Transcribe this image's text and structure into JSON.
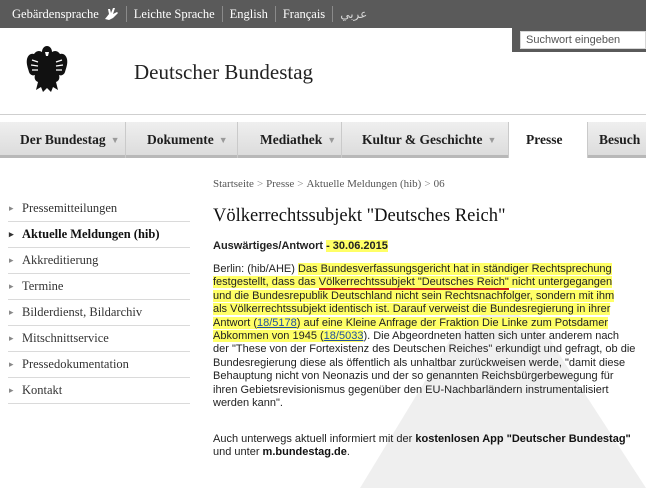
{
  "topbar": {
    "items": [
      "Gebärdensprache",
      "Leichte Sprache",
      "English",
      "Français",
      "عربي"
    ]
  },
  "header": {
    "site_title": "Deutscher Bundestag",
    "search_placeholder": "Suchwort eingeben"
  },
  "mainnav": {
    "items": [
      "Der Bundestag",
      "Dokumente",
      "Mediathek",
      "Kultur & Geschichte",
      "Presse",
      "Besuch"
    ],
    "active": "Presse"
  },
  "sidebar": {
    "items": [
      "Pressemitteilungen",
      "Aktuelle Meldungen (hib)",
      "Akkreditierung",
      "Termine",
      "Bilderdienst, Bildarchiv",
      "Mitschnittservice",
      "Pressedokumentation",
      "Kontakt"
    ],
    "active": "Aktuelle Meldungen (hib)"
  },
  "breadcrumb": {
    "items": [
      "Startseite",
      "Presse",
      "Aktuelle Meldungen (hib)",
      "06"
    ],
    "separator": ">"
  },
  "article": {
    "title": "Völkerrechtssubjekt \"Deutsches Reich\"",
    "section": "Auswärtiges/Antwort",
    "date": "- 30.06.2015",
    "lines": [
      [
        "Berlin: (hib/AHE) ",
        "Das Bundesverfassungsgericht hat in ständiger Rechtsprechung"
      ],
      [
        "festgestellt, dass das ",
        "Völkerrechtssubjekt \"Deutsches Reich\"",
        " nicht untergegangen"
      ],
      [
        "und die Bundesrepublik Deutschland nicht sein Rechtsnachfolger, sondern mit ihm"
      ],
      [
        "als Völkerrechtssubjekt identisch ist. Darauf verweist die Bundesregierung in ihrer"
      ],
      [
        "Antwort (",
        "18/5178",
        ") auf eine Kleine Anfrage der Fraktion Die Linke zum Potsdamer"
      ],
      [
        "Abkommen von 1945 (",
        "18/5033",
        "). Die Abgeordneten hatten sich unter anderem nach"
      ],
      [
        "der \"These von der Fortexistenz des Deutschen Reiches\" erkundigt und gefragt, ob die"
      ],
      [
        "Bundesregierung diese als öffentlich als unhaltbar zurückweisen werde, \"damit diese"
      ],
      [
        "Behauptung nicht von Neonazis und der so genannten Reichsbürgerbewegung für"
      ],
      [
        "ihren Gebietsrevisionismus gegenüber den EU-Nachbarländern instrumentalisiert"
      ],
      [
        "werden kann\"."
      ]
    ]
  },
  "footer_note": {
    "prefix": "Auch unterwegs aktuell informiert mit der ",
    "app": "kostenlosen App \"Deutscher Bundestag\"",
    "middle": "und unter ",
    "url": "m.bundestag.de",
    "suffix": "."
  },
  "colors": {
    "topbar": "#5a5a5a",
    "highlight": "#ffff66",
    "underline": "#d01818",
    "link": "#2050a0"
  }
}
